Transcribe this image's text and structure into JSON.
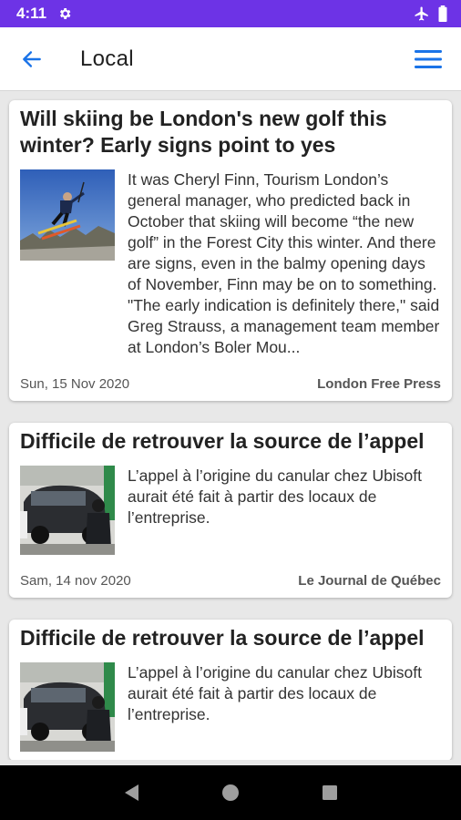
{
  "status_bar": {
    "time": "4:11"
  },
  "app_bar": {
    "title": "Local"
  },
  "articles": [
    {
      "title": "Will skiing be London's new golf this winter? Early signs point to yes",
      "excerpt": "It was Cheryl Finn, Tourism London’s general manager, who predicted back in October that skiing will become “the new golf” in the Forest City this winter. And there are signs, even in the balmy opening days of November, Finn may be on to something. \"The early indication is definitely there,\" said Greg Strauss, a management team member at London’s Boler Mou...",
      "date": "Sun, 15 Nov 2020",
      "source": "London Free Press"
    },
    {
      "title": "Difficile de retrouver la source de l’appel",
      "excerpt": "L’appel à l’origine du canular chez Ubisoft aurait été fait à partir des locaux de l’entreprise.",
      "date": "Sam, 14 nov 2020",
      "source": "Le Journal de Québec"
    },
    {
      "title": "Difficile de retrouver la source de l’appel",
      "excerpt": "L’appel à l’origine du canular chez Ubisoft aurait été fait à partir des locaux de l’entreprise."
    }
  ],
  "colors": {
    "status_bar": "#6d33e6",
    "accent": "#1a73e8"
  },
  "icons": {
    "back": "arrow-left-icon",
    "menu": "hamburger-menu-icon",
    "settings": "gear-icon",
    "airplane": "airplane-icon",
    "battery": "battery-icon"
  }
}
